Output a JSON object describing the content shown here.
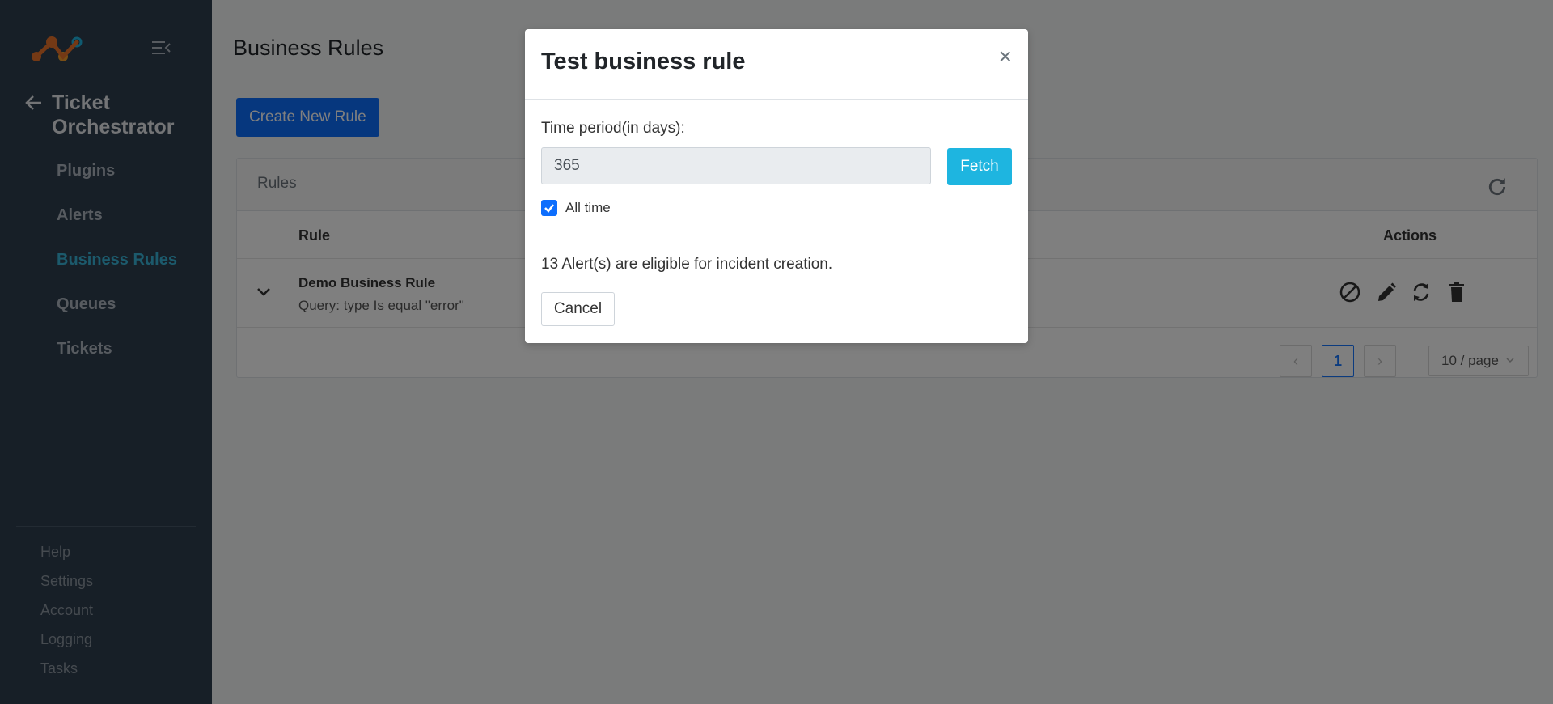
{
  "sidebar": {
    "app_title": "Ticket Orchestrator",
    "nav": [
      {
        "label": "Plugins"
      },
      {
        "label": "Alerts"
      },
      {
        "label": "Business Rules"
      },
      {
        "label": "Queues"
      },
      {
        "label": "Tickets"
      }
    ],
    "active_item": "Business Rules",
    "footer": [
      {
        "label": "Help"
      },
      {
        "label": "Settings"
      },
      {
        "label": "Account"
      },
      {
        "label": "Logging"
      },
      {
        "label": "Tasks"
      }
    ]
  },
  "main": {
    "page_title": "Business Rules",
    "create_button_label": "Create New Rule",
    "card_title": "Rules",
    "table": {
      "columns": [
        "Rule",
        "Actions"
      ],
      "rows": [
        {
          "name": "Demo Business Rule",
          "query": "Query: type Is equal \"error\""
        }
      ]
    },
    "pagination": {
      "current_page": "1",
      "page_size": "10 / page"
    }
  },
  "modal": {
    "title": "Test business rule",
    "close_symbol": "×",
    "period_label": "Time period(in days):",
    "period_value": "365",
    "fetch_label": "Fetch",
    "all_time_label": "All time",
    "all_time_checked": true,
    "result_text": "13 Alert(s) are eligible for incident creation.",
    "cancel_label": "Cancel"
  },
  "colors": {
    "sidebar_bg": "#2f3e4f",
    "nav_active": "#38b5d8",
    "primary": "#0d6efd",
    "fetch": "#1eb5e0"
  },
  "icons": [
    "logo-icon",
    "collapse-icon",
    "back-arrow-icon",
    "refresh-icon",
    "chevron-down-icon",
    "disable-icon",
    "edit-icon",
    "sync-icon",
    "trash-icon"
  ]
}
